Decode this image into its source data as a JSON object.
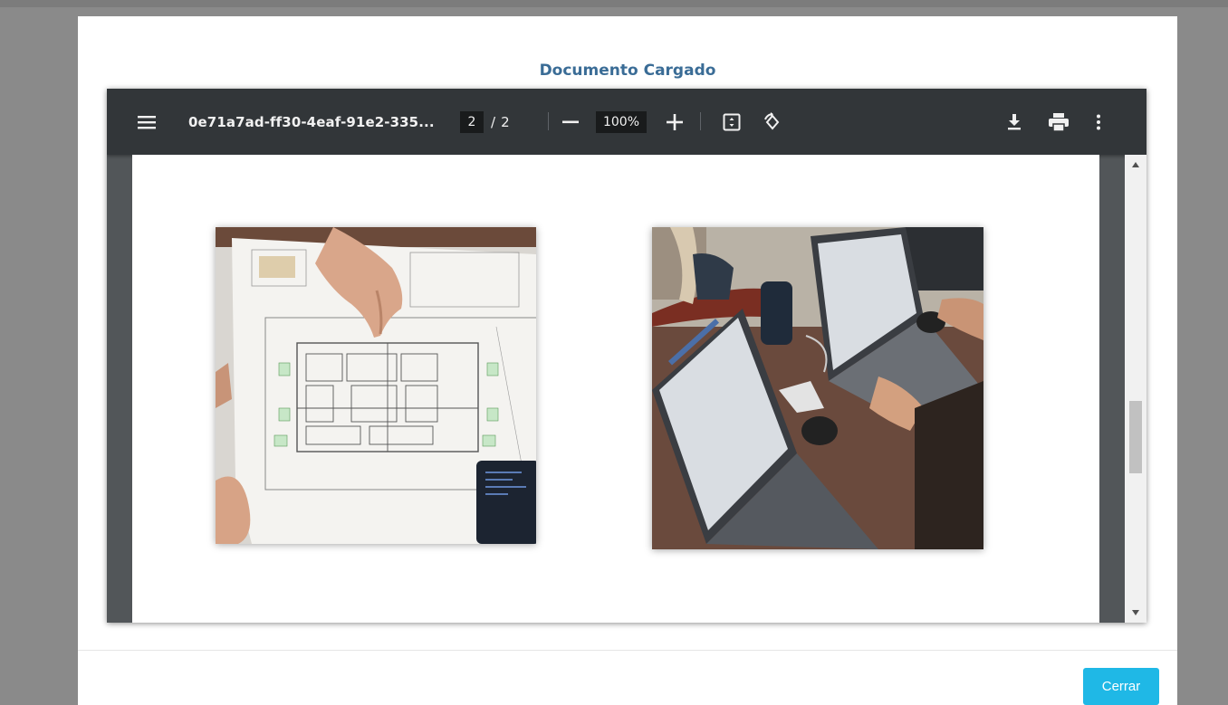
{
  "modal": {
    "title": "Documento Cargado",
    "close_label": "Cerrar"
  },
  "viewer": {
    "doc_name": "0e71a7ad-ff30-4eaf-91e2-335...",
    "current_page": "2",
    "page_separator": "/",
    "total_pages": "2",
    "zoom": "100%",
    "icons": [
      "menu-icon",
      "zoom-out-icon",
      "zoom-in-icon",
      "fit-page-icon",
      "rotate-icon",
      "download-icon",
      "print-icon",
      "more-vert-icon"
    ],
    "scroll_position": 0.55
  },
  "colors": {
    "toolbar": "#323639",
    "viewer_bg": "#525659",
    "title": "#3a6c96",
    "button": "#1fb8e6"
  }
}
